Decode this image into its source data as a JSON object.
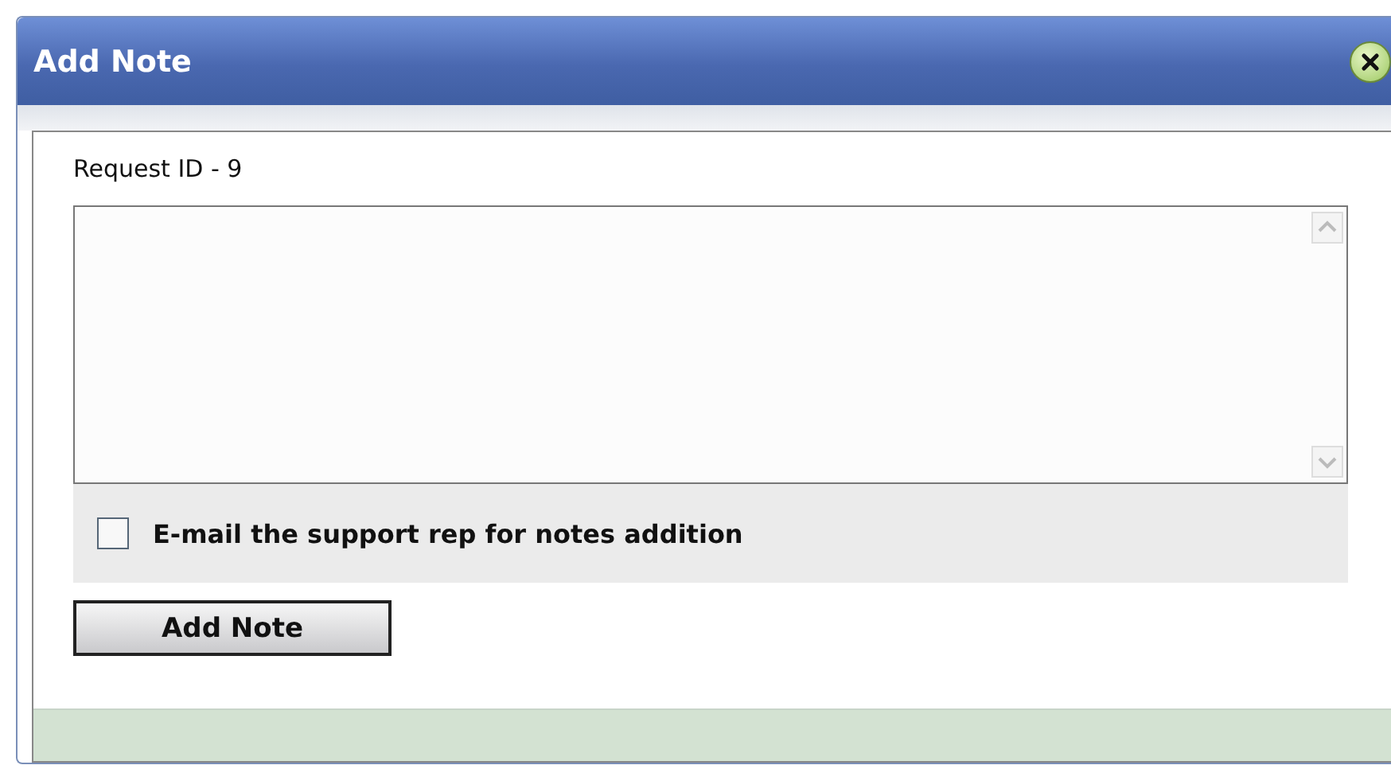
{
  "window": {
    "title": "Add Note"
  },
  "request_label": "Request ID - 9",
  "email_option": {
    "label": "E-mail the support rep for notes addition",
    "checked": false
  },
  "buttons": [
    "Add Note"
  ]
}
